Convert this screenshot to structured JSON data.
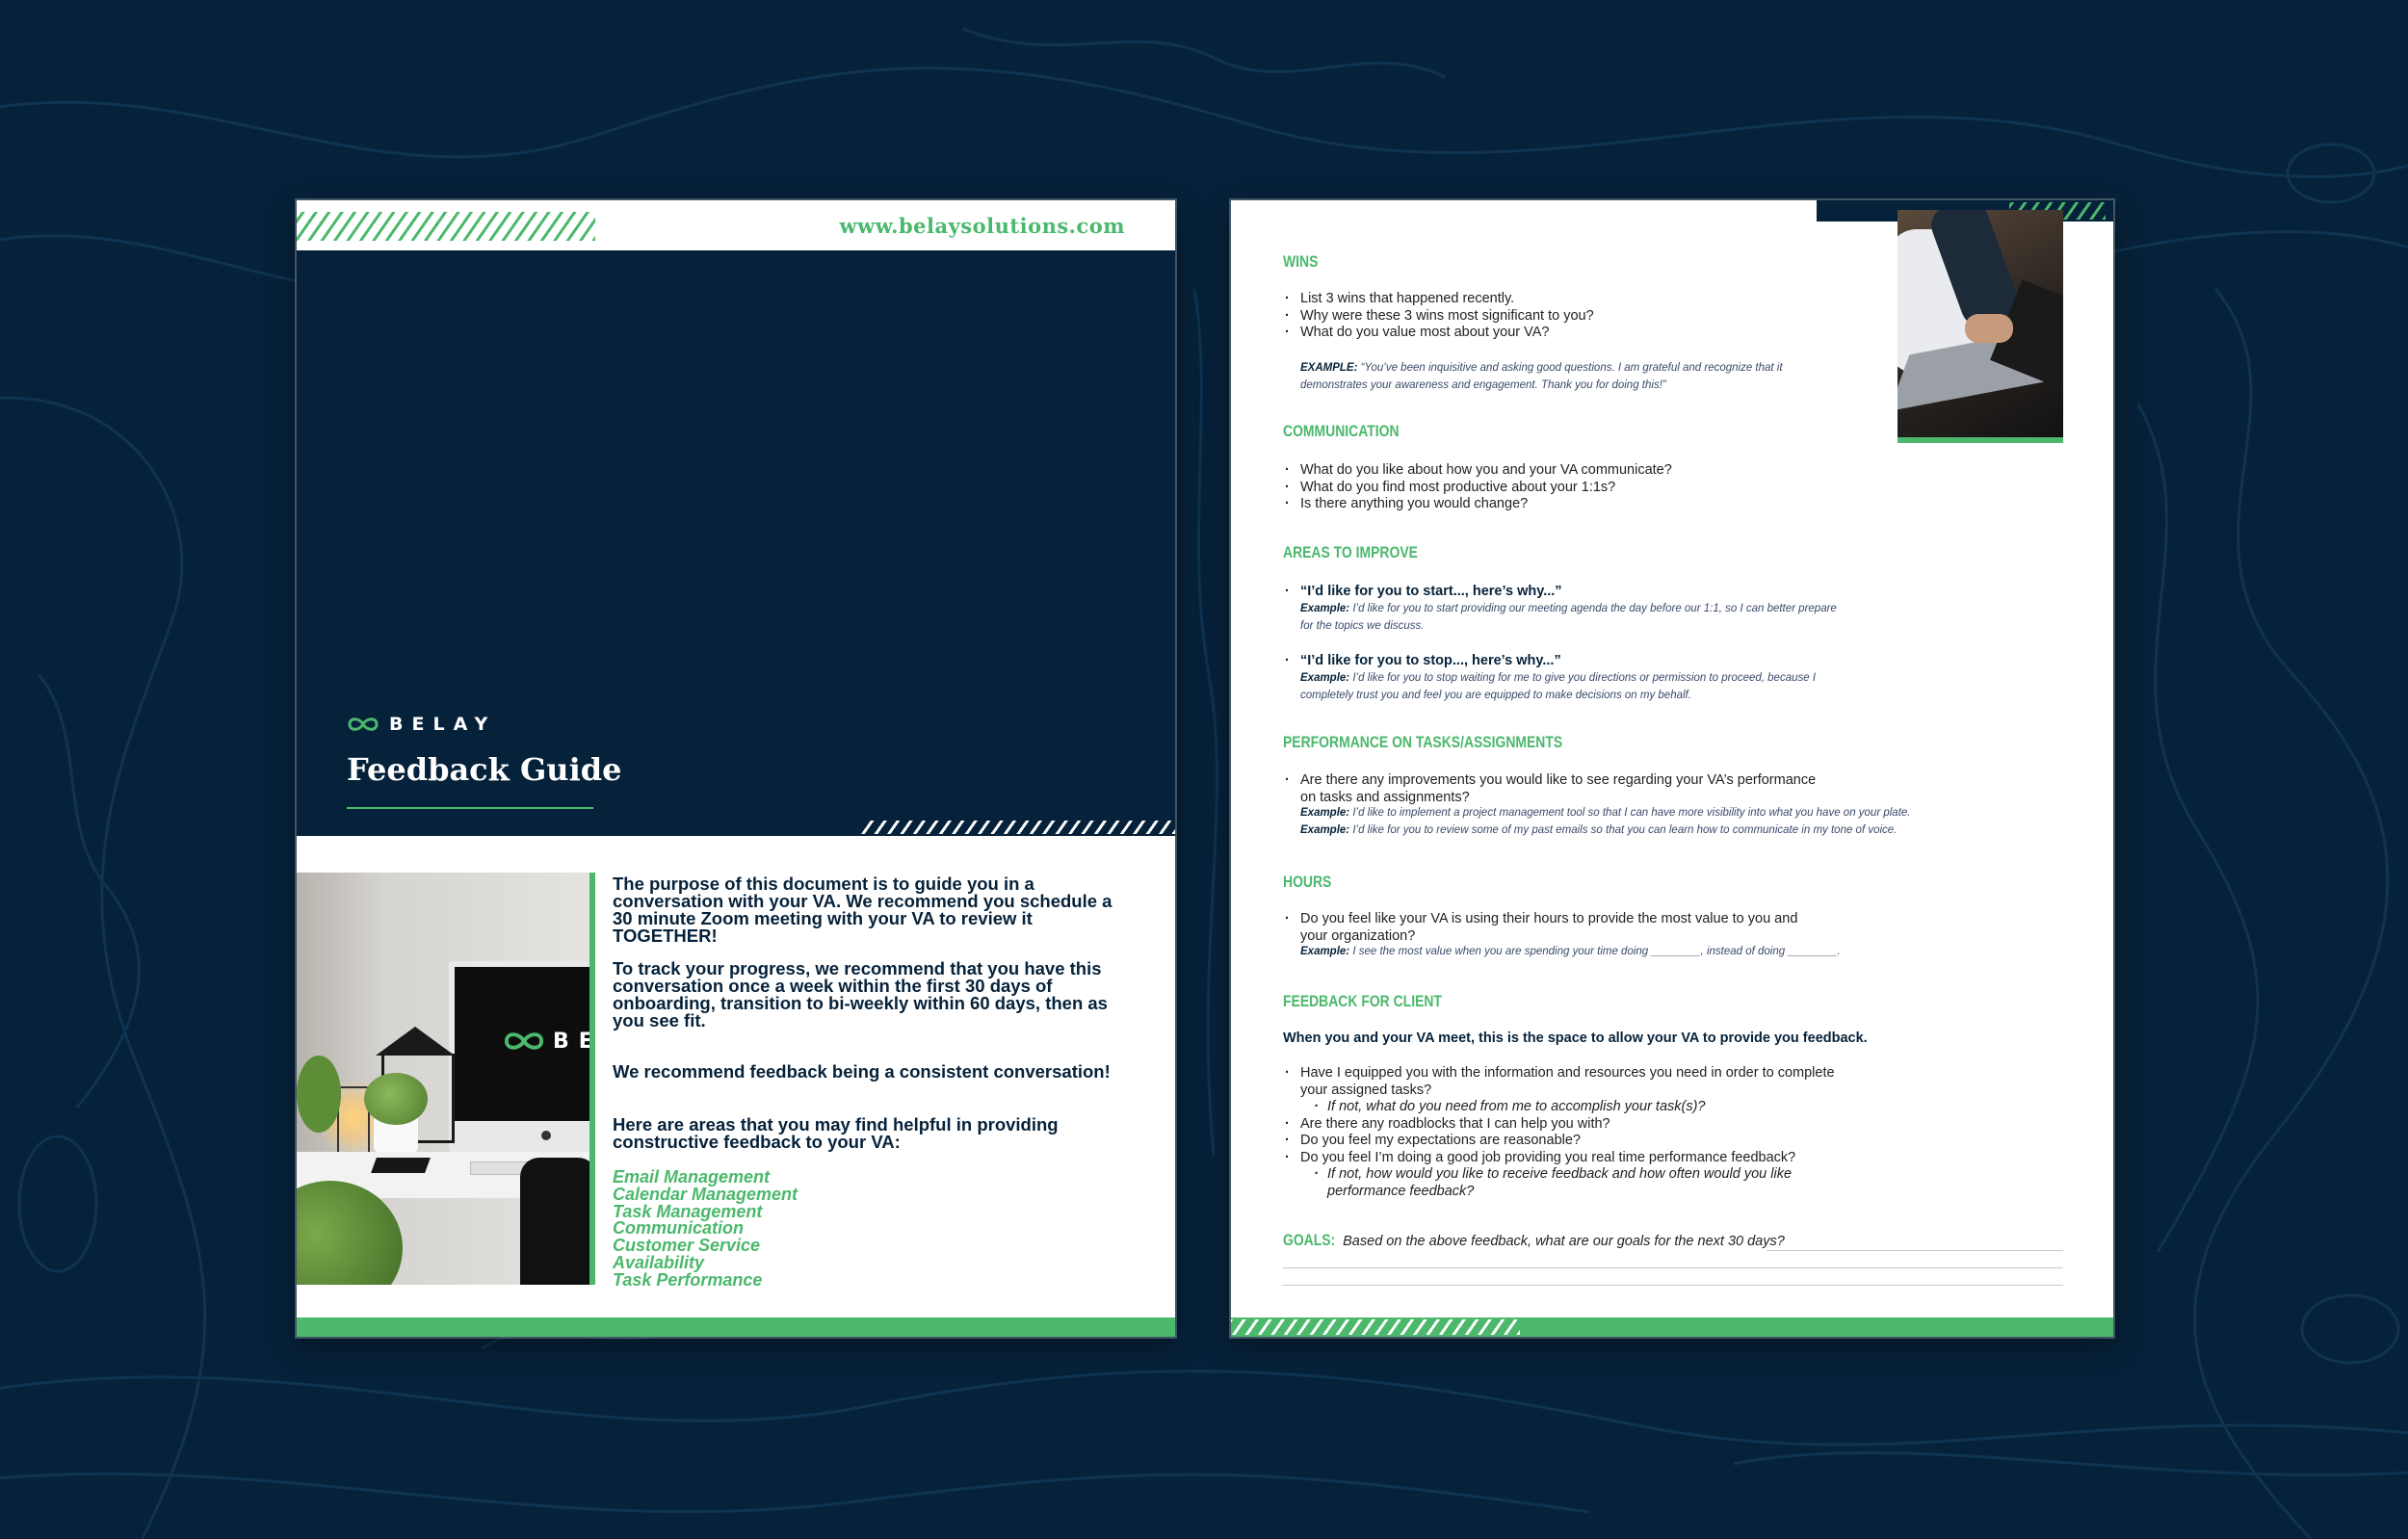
{
  "page1": {
    "url": "www.belaysolutions.com",
    "brand": "BELAY",
    "title": "Feedback Guide",
    "photo_logo_text": "BE",
    "paragraphs": [
      "The purpose of this document is to guide you in a conversation with your VA. We recommend you schedule a 30 minute Zoom meeting with your VA to review it TOGETHER!",
      "To track your progress, we recommend that you have this conversation once a week within the first 30 days of onboarding, transition to bi-weekly within 60 days, then as you see fit.",
      "We recommend feedback being a consistent conversation!",
      "Here are areas that you may find helpful in providing constructive feedback to your VA:"
    ],
    "areas": [
      "Email Management",
      "Calendar Management",
      "Task Management",
      "Communication",
      "Customer Service",
      "Availability",
      "Task Performance"
    ]
  },
  "page2": {
    "wins": {
      "heading": "WINS",
      "items": [
        "List 3 wins that happened recently.",
        "Why were these 3 wins most significant to you?",
        "What do you value most about your VA?"
      ],
      "example_label": "EXAMPLE:",
      "example_line1": "“You’ve been inquisitive and asking good questions. I am grateful and recognize that it",
      "example_line2": "demonstrates your awareness and engagement. Thank you for doing this!”"
    },
    "communication": {
      "heading": "COMMUNICATION",
      "items": [
        "What do you like about how you and your VA communicate?",
        "What do you find most productive about your 1:1s?",
        "Is there anything you would change?"
      ]
    },
    "improve": {
      "heading": "AREAS TO IMPROVE",
      "q1": "“I’d like for you to start..., here’s why...”",
      "ex_label": "Example:",
      "ex1_line1": "I’d like for you to start providing our meeting agenda the day before our 1:1, so I can better prepare",
      "ex1_line2": "for the topics we discuss.",
      "q2": "“I’d like for you to stop..., here’s why...”",
      "ex2_line1": "I’d like for you to stop waiting for me to give you directions or permission to proceed, because I",
      "ex2_line2": "completely trust you and feel you are equipped to make decisions on my behalf."
    },
    "performance": {
      "heading": "PERFORMANCE ON TASKS/ASSIGNMENTS",
      "item_line1": "Are there any improvements you would like to see regarding your VA’s performance",
      "item_line2": "on tasks and assignments?",
      "ex_label": "Example:",
      "ex1": "I’d like to implement a project management tool so that I can have more visibility into what you have on your plate.",
      "ex2": "I’d like for you to review some of my past emails so that you can learn how to communicate in my tone of voice."
    },
    "hours": {
      "heading": "HOURS",
      "item_line1": "Do you feel like your VA is using their hours to provide the most value to you and",
      "item_line2": "your organization?",
      "ex_label": "Example:",
      "ex": "I see the most value when you are spending your time doing ________, instead of doing ________."
    },
    "client": {
      "heading": "FEEDBACK FOR CLIENT",
      "lead": "When you and your VA meet, this is the space to allow your VA to provide you feedback.",
      "i1_line1": "Have I equipped you with the information and resources you need in order to complete",
      "i1_line2": "your assigned tasks?",
      "i1_sub": "If not, what do you need from me to accomplish your task(s)?",
      "i2": "Are there any roadblocks that I can help you with?",
      "i3": "Do you feel my expectations are reasonable?",
      "i4": "Do you feel I’m doing a good job providing you real time performance feedback?",
      "i4_sub_line1": "If not, how would you like to receive feedback and how often would you like",
      "i4_sub_line2": "performance feedback?"
    },
    "goals": {
      "label": "GOALS:",
      "text": "Based on the above feedback, what are our goals for the next 30 days?"
    }
  },
  "colors": {
    "navy": "#06223a",
    "green": "#4bb86c"
  }
}
